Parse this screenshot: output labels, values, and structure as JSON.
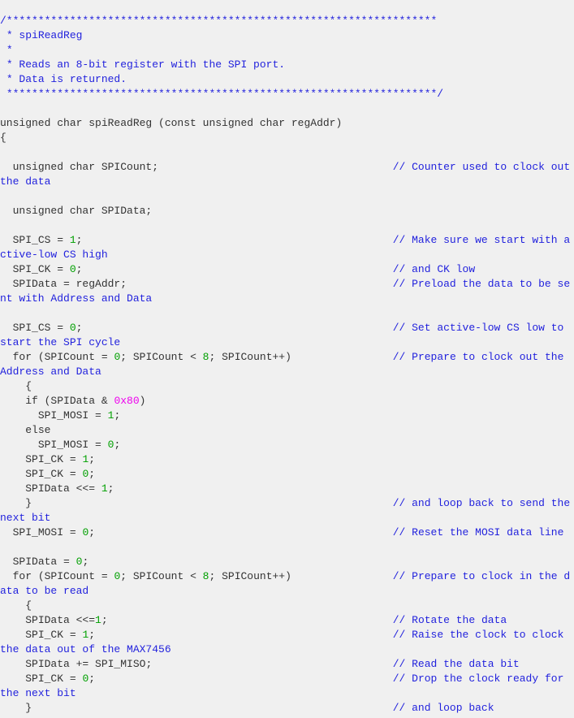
{
  "editor": {
    "background_color": "#f0f0f0",
    "font_size_px": 13,
    "line_height_px": 18,
    "language": "C"
  },
  "palette": {
    "comment": "#2222dd",
    "code": "#333333",
    "number": "#00a000",
    "hex_literal": "#ee00ee"
  },
  "source": {
    "function_name": "spiReadReg",
    "comment_column": 62,
    "lines": [
      {
        "id": "l1",
        "segments": [
          {
            "t": "cmt",
            "v": "/********************************************************************"
          }
        ]
      },
      {
        "id": "l2",
        "segments": [
          {
            "t": "cmt",
            "v": " * spiReadReg"
          }
        ]
      },
      {
        "id": "l3",
        "segments": [
          {
            "t": "cmt",
            "v": " *"
          }
        ]
      },
      {
        "id": "l4",
        "segments": [
          {
            "t": "cmt",
            "v": " * Reads an 8-bit register with the SPI port."
          }
        ]
      },
      {
        "id": "l5",
        "segments": [
          {
            "t": "cmt",
            "v": " * Data is returned."
          }
        ]
      },
      {
        "id": "l6",
        "segments": [
          {
            "t": "cmt",
            "v": " ********************************************************************/"
          }
        ]
      },
      {
        "id": "l7",
        "segments": []
      },
      {
        "id": "l8",
        "segments": [
          {
            "t": "code",
            "v": "unsigned char spiReadReg (const unsigned char regAddr)"
          }
        ]
      },
      {
        "id": "l9",
        "segments": [
          {
            "t": "code",
            "v": "{"
          }
        ]
      },
      {
        "id": "l10",
        "segments": []
      },
      {
        "id": "l11",
        "segments": [
          {
            "t": "code",
            "v": "  unsigned char SPICount;"
          },
          {
            "t": "pad",
            "v": ""
          },
          {
            "t": "cmt",
            "v": "// Counter used to clock out the data"
          }
        ]
      },
      {
        "id": "l12",
        "segments": []
      },
      {
        "id": "l13",
        "segments": [
          {
            "t": "code",
            "v": "  unsigned char SPIData;"
          }
        ]
      },
      {
        "id": "l14",
        "segments": []
      },
      {
        "id": "l15",
        "segments": [
          {
            "t": "code",
            "v": "  SPI_CS = "
          },
          {
            "t": "num",
            "v": "1"
          },
          {
            "t": "code",
            "v": ";"
          },
          {
            "t": "pad",
            "v": ""
          },
          {
            "t": "cmt",
            "v": "// Make sure we start with active-low CS high"
          }
        ]
      },
      {
        "id": "l16",
        "segments": [
          {
            "t": "code",
            "v": "  SPI_CK = "
          },
          {
            "t": "num",
            "v": "0"
          },
          {
            "t": "code",
            "v": ";"
          },
          {
            "t": "pad",
            "v": ""
          },
          {
            "t": "cmt",
            "v": "// and CK low"
          }
        ]
      },
      {
        "id": "l17",
        "segments": [
          {
            "t": "code",
            "v": "  SPIData = regAddr;"
          },
          {
            "t": "pad",
            "v": ""
          },
          {
            "t": "cmt",
            "v": "// Preload the data to be sent with Address and Data"
          }
        ]
      },
      {
        "id": "l18",
        "segments": []
      },
      {
        "id": "l19",
        "segments": [
          {
            "t": "code",
            "v": "  SPI_CS = "
          },
          {
            "t": "num",
            "v": "0"
          },
          {
            "t": "code",
            "v": ";"
          },
          {
            "t": "pad",
            "v": ""
          },
          {
            "t": "cmt",
            "v": "// Set active-low CS low to start the SPI cycle"
          }
        ]
      },
      {
        "id": "l20",
        "segments": [
          {
            "t": "code",
            "v": "  for (SPICount = "
          },
          {
            "t": "num",
            "v": "0"
          },
          {
            "t": "code",
            "v": "; SPICount < "
          },
          {
            "t": "num",
            "v": "8"
          },
          {
            "t": "code",
            "v": "; SPICount++)"
          },
          {
            "t": "pad",
            "v": ""
          },
          {
            "t": "cmt",
            "v": "// Prepare to clock out the Address and Data"
          }
        ]
      },
      {
        "id": "l21",
        "segments": [
          {
            "t": "code",
            "v": "    {"
          }
        ]
      },
      {
        "id": "l22",
        "segments": [
          {
            "t": "code",
            "v": "    if (SPIData & "
          },
          {
            "t": "hex",
            "v": "0x80"
          },
          {
            "t": "code",
            "v": ")"
          }
        ]
      },
      {
        "id": "l23",
        "segments": [
          {
            "t": "code",
            "v": "      SPI_MOSI = "
          },
          {
            "t": "num",
            "v": "1"
          },
          {
            "t": "code",
            "v": ";"
          }
        ]
      },
      {
        "id": "l24",
        "segments": [
          {
            "t": "code",
            "v": "    else"
          }
        ]
      },
      {
        "id": "l25",
        "segments": [
          {
            "t": "code",
            "v": "      SPI_MOSI = "
          },
          {
            "t": "num",
            "v": "0"
          },
          {
            "t": "code",
            "v": ";"
          }
        ]
      },
      {
        "id": "l26",
        "segments": [
          {
            "t": "code",
            "v": "    SPI_CK = "
          },
          {
            "t": "num",
            "v": "1"
          },
          {
            "t": "code",
            "v": ";"
          }
        ]
      },
      {
        "id": "l27",
        "segments": [
          {
            "t": "code",
            "v": "    SPI_CK = "
          },
          {
            "t": "num",
            "v": "0"
          },
          {
            "t": "code",
            "v": ";"
          }
        ]
      },
      {
        "id": "l28",
        "segments": [
          {
            "t": "code",
            "v": "    SPIData <<= "
          },
          {
            "t": "num",
            "v": "1"
          },
          {
            "t": "code",
            "v": ";"
          }
        ]
      },
      {
        "id": "l29",
        "segments": [
          {
            "t": "code",
            "v": "    }"
          },
          {
            "t": "pad",
            "v": ""
          },
          {
            "t": "cmt",
            "v": "// and loop back to send the next bit"
          }
        ]
      },
      {
        "id": "l30",
        "segments": [
          {
            "t": "code",
            "v": "  SPI_MOSI = "
          },
          {
            "t": "num",
            "v": "0"
          },
          {
            "t": "code",
            "v": ";"
          },
          {
            "t": "pad",
            "v": ""
          },
          {
            "t": "cmt",
            "v": "// Reset the MOSI data line"
          }
        ]
      },
      {
        "id": "l31",
        "segments": []
      },
      {
        "id": "l32",
        "segments": [
          {
            "t": "code",
            "v": "  SPIData = "
          },
          {
            "t": "num",
            "v": "0"
          },
          {
            "t": "code",
            "v": ";"
          }
        ]
      },
      {
        "id": "l33",
        "segments": [
          {
            "t": "code",
            "v": "  for (SPICount = "
          },
          {
            "t": "num",
            "v": "0"
          },
          {
            "t": "code",
            "v": "; SPICount < "
          },
          {
            "t": "num",
            "v": "8"
          },
          {
            "t": "code",
            "v": "; SPICount++)"
          },
          {
            "t": "pad",
            "v": ""
          },
          {
            "t": "cmt",
            "v": "// Prepare to clock in the data to be read"
          }
        ]
      },
      {
        "id": "l34",
        "segments": [
          {
            "t": "code",
            "v": "    {"
          }
        ]
      },
      {
        "id": "l35",
        "segments": [
          {
            "t": "code",
            "v": "    SPIData <<="
          },
          {
            "t": "num",
            "v": "1"
          },
          {
            "t": "code",
            "v": ";"
          },
          {
            "t": "pad",
            "v": ""
          },
          {
            "t": "cmt",
            "v": "// Rotate the data"
          }
        ]
      },
      {
        "id": "l36",
        "segments": [
          {
            "t": "code",
            "v": "    SPI_CK = "
          },
          {
            "t": "num",
            "v": "1"
          },
          {
            "t": "code",
            "v": ";"
          },
          {
            "t": "pad",
            "v": ""
          },
          {
            "t": "cmt",
            "v": "// Raise the clock to clock the data out of the MAX7456"
          }
        ]
      },
      {
        "id": "l37",
        "segments": [
          {
            "t": "code",
            "v": "    SPIData += SPI_MISO;"
          },
          {
            "t": "pad",
            "v": ""
          },
          {
            "t": "cmt",
            "v": "// Read the data bit"
          }
        ]
      },
      {
        "id": "l38",
        "segments": [
          {
            "t": "code",
            "v": "    SPI_CK = "
          },
          {
            "t": "num",
            "v": "0"
          },
          {
            "t": "code",
            "v": ";"
          },
          {
            "t": "pad",
            "v": ""
          },
          {
            "t": "cmt",
            "v": "// Drop the clock ready for the next bit"
          }
        ]
      },
      {
        "id": "l39",
        "segments": [
          {
            "t": "code",
            "v": "    }"
          },
          {
            "t": "pad",
            "v": ""
          },
          {
            "t": "cmt",
            "v": "// and loop back"
          }
        ]
      }
    ]
  }
}
